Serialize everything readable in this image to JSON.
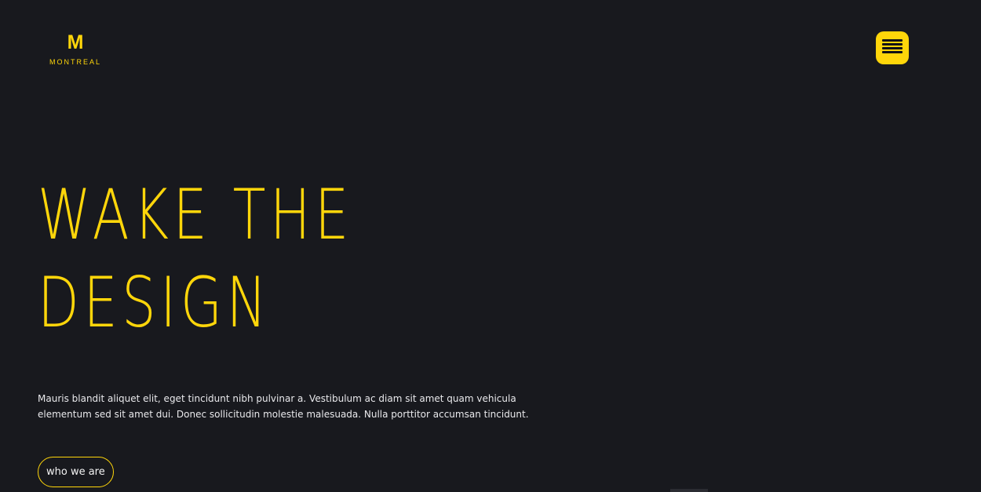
{
  "header": {
    "logo_mark": "M",
    "logo_name": "MONTREAL",
    "menu_icon": "hamburger-menu-icon"
  },
  "hero": {
    "title_line1": "WAKE THE",
    "title_line2": "DESIGN",
    "description": "Mauris blandit aliquet elit, eget tincidunt nibh pulvinar a. Vestibulum ac diam sit amet quam vehicula elementum sed sit amet dui. Donec sollicitudin molestie malesuada. Nulla porttitor accumsan tincidunt.",
    "cta_label": "who we are"
  },
  "colors": {
    "background": "#18191e",
    "accent": "#ffd60a",
    "text": "#e9e9ec"
  }
}
